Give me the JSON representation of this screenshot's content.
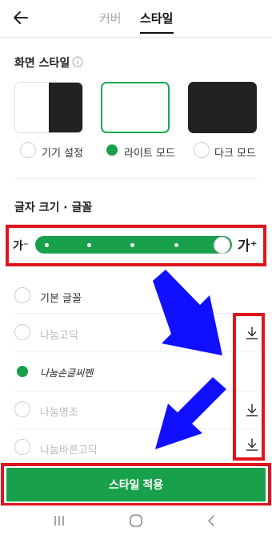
{
  "header": {
    "tabs": [
      {
        "label": "커버",
        "active": false
      },
      {
        "label": "스타일",
        "active": true
      }
    ]
  },
  "screen_style": {
    "title": "화면 스타일",
    "options": [
      {
        "label": "기기 설정",
        "selected": false
      },
      {
        "label": "라이트 모드",
        "selected": true
      },
      {
        "label": "다크 모드",
        "selected": false
      }
    ]
  },
  "font_section": {
    "title": "글자 크기 · 글꼴",
    "size_small_label": "가⁻",
    "size_large_label": "가⁺",
    "size_levels": 6,
    "size_selected_level": 6,
    "fonts": [
      {
        "label": "기본 글꼴",
        "enabled": true,
        "selected": false,
        "downloadable": false
      },
      {
        "label": "나눔고딕",
        "enabled": false,
        "selected": false,
        "downloadable": true
      },
      {
        "label": "나눔손글씨펜",
        "enabled": true,
        "selected": true,
        "downloadable": false
      },
      {
        "label": "나눔명조",
        "enabled": false,
        "selected": false,
        "downloadable": true
      },
      {
        "label": "나눔바른고딕",
        "enabled": false,
        "selected": false,
        "downloadable": true
      }
    ]
  },
  "apply_button": {
    "label": "스타일 적용"
  },
  "colors": {
    "accent_green": "#19a04b",
    "annotation_red": "#e0141e",
    "annotation_blue": "#1010ff"
  }
}
